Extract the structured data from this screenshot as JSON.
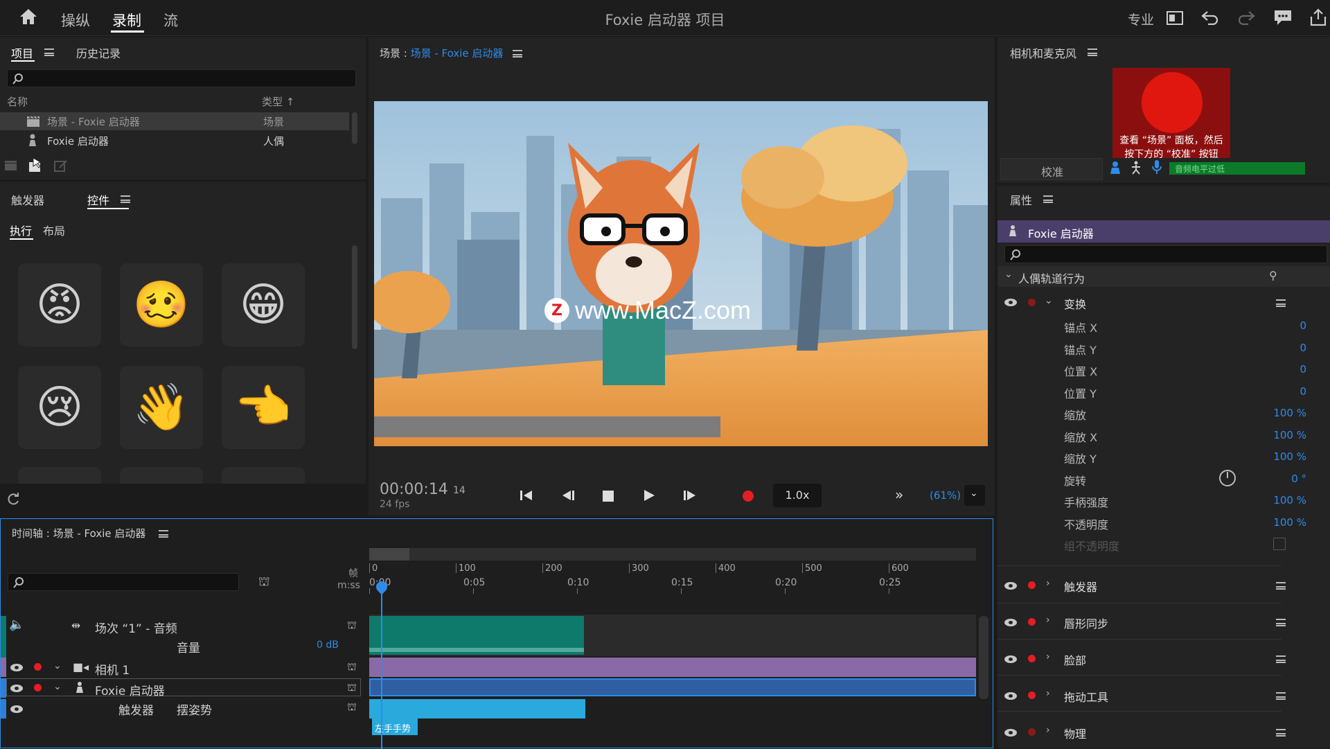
{
  "topbar": {
    "tabs": [
      "操纵",
      "录制",
      "流"
    ],
    "title": "Foxie 启动器 项目",
    "mode_label": "专业"
  },
  "project_panel": {
    "tabs": [
      "项目",
      "历史记录"
    ],
    "col_name": "名称",
    "col_type": "类型",
    "rows": [
      {
        "name": "场景 - Foxie 启动器",
        "type": "场景"
      },
      {
        "name": "Foxie 启动器",
        "type": "人偶"
      }
    ]
  },
  "triggers_panel": {
    "tabs": [
      "触发器",
      "控件"
    ],
    "subtabs": [
      "执行",
      "布局"
    ],
    "emojis": [
      "😡",
      "🥴",
      "😁",
      "😢",
      "👋",
      "👈"
    ]
  },
  "scene_panel": {
    "prefix": "场景 : ",
    "scene_name": "场景 - Foxie 启动器",
    "watermark": "www.MacZ.com",
    "watermark_badge": "Z",
    "timecode": "00:00:14",
    "frame": "14",
    "fps": "24 fps",
    "speed": "1.0x",
    "zoom": "(61%)"
  },
  "camera_panel": {
    "title": "相机和麦克风",
    "overlay_text_1": "查看 “场景” 面板，然后",
    "overlay_text_2": "按下方的 “校准” 按钮",
    "calibrate": "校准",
    "mic_status": "音频电平过低"
  },
  "properties_panel": {
    "title": "属性",
    "puppet": "Foxie 启动器",
    "section": "人偶轨道行为",
    "transform": "变换",
    "props": [
      {
        "label": "锚点 X",
        "value": "0"
      },
      {
        "label": "锚点 Y",
        "value": "0"
      },
      {
        "label": "位置 X",
        "value": "0"
      },
      {
        "label": "位置 Y",
        "value": "0"
      },
      {
        "label": "缩放",
        "value": "100 %"
      },
      {
        "label": "缩放 X",
        "value": "100 %"
      },
      {
        "label": "缩放 Y",
        "value": "100 %"
      },
      {
        "label": "旋转",
        "value": "0 °"
      },
      {
        "label": "手柄强度",
        "value": "100 %"
      },
      {
        "label": "不透明度",
        "value": "100 %"
      },
      {
        "label": "组不透明度",
        "value": ""
      }
    ],
    "behaviors": [
      "触发器",
      "唇形同步",
      "脸部",
      "拖动工具",
      "物理"
    ]
  },
  "timeline": {
    "title": "时间轴 : 场景 - Foxie 启动器",
    "frames_label": "帧",
    "time_label": "m:ss",
    "frame_ticks": [
      "0",
      "100",
      "200",
      "300",
      "400",
      "500",
      "600"
    ],
    "time_ticks": [
      "0:00",
      "0:05",
      "0:10",
      "0:15",
      "0:20",
      "0:25"
    ],
    "tracks": {
      "audio_name": "场次 “1” - 音频",
      "volume_label": "音量",
      "volume_value": "0 dB",
      "camera": "相机 1",
      "puppet": "Foxie 启动器",
      "trigger_label": "触发器",
      "trigger_value": "摆姿势",
      "clip_label": "左手手势"
    }
  },
  "colors": {
    "accent": "#2d8ceb",
    "record": "#e31e24",
    "audio_clip": "#0e7a6c",
    "camera_clip": "#8a6aa6",
    "puppet_clip": "#2f7fd6",
    "trigger_clip": "#29a9dc"
  }
}
